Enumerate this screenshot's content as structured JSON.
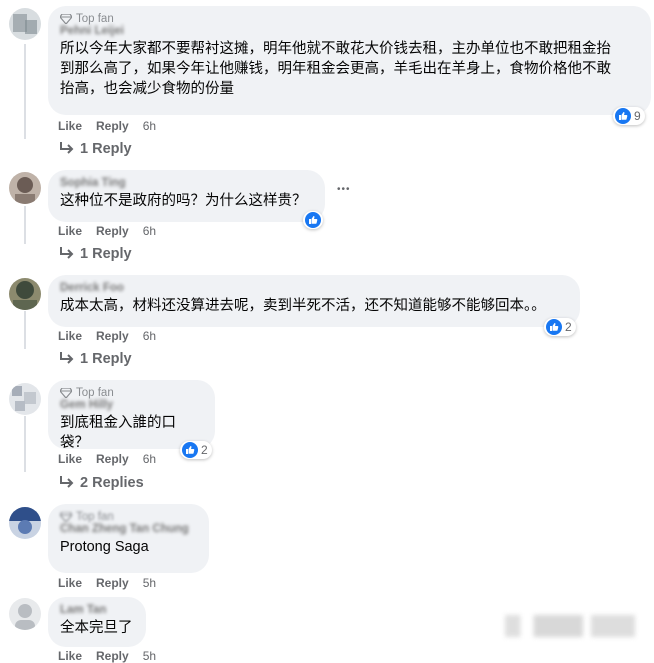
{
  "comments": [
    {
      "badge": "Top fan",
      "author": "Pehni Leijei",
      "text": "所以今年大家都不要帮衬这摊，明年他就不敢花大价钱去租，主办单位也不敢把租金抬\n到那么高了，如果今年让他赚钱，明年租金会更高，羊毛出在羊身上，食物价格他不敢\n抬高，也会减少食物的份量",
      "like": "Like",
      "reply": "Reply",
      "time": "6h",
      "reactions": "9",
      "replies": "1 Reply",
      "avatar_colors": [
        "#9aa3a8",
        "#d8dde0"
      ]
    },
    {
      "author": "Sophia Ting",
      "text": "这种位不是政府的吗？为什么这样贵？",
      "like": "Like",
      "reply": "Reply",
      "time": "6h",
      "replies": "1 Reply",
      "more": "•••",
      "avatar_colors": [
        "#6b5c55",
        "#bfb2a8"
      ]
    },
    {
      "author": "Derrick Foo",
      "text": "成本太高，材料还没算进去呢，卖到半死不活，还不知道能够不能够回本。。",
      "like": "Like",
      "reply": "Reply",
      "time": "6h",
      "reactions": "2",
      "replies": "1 Reply",
      "avatar_colors": [
        "#3f4a3c",
        "#8c8a6e"
      ]
    },
    {
      "badge": "Top fan",
      "author": "Gem Hilly",
      "text": "到底租金入誰的口袋？",
      "like": "Like",
      "reply": "Reply",
      "time": "6h",
      "reactions": "2",
      "replies": "2 Replies",
      "avatar_colors": [
        "#a6adb8",
        "#e3e6ea"
      ]
    },
    {
      "badge": "Top fan",
      "author": "Chan Zheng Tan Chung",
      "text": "Protong Saga",
      "like": "Like",
      "reply": "Reply",
      "time": "5h",
      "avatar_colors": [
        "#2f4f8a",
        "#c9d3e3"
      ]
    },
    {
      "author": "Lam Tan",
      "text": "全本完旦了",
      "like": "Like",
      "reply": "Reply",
      "time": "5h",
      "avatar_colors": [
        "#b9bdc2",
        "#e8eaec"
      ]
    }
  ],
  "icons": {
    "badge": "diamond-badge-icon",
    "reply_arrow": "reply-arrow-icon",
    "like_reaction": "like-reaction-icon"
  },
  "colors": {
    "like_blue": "#1877f2",
    "bubble": "#f0f2f5",
    "meta": "#65676b"
  }
}
